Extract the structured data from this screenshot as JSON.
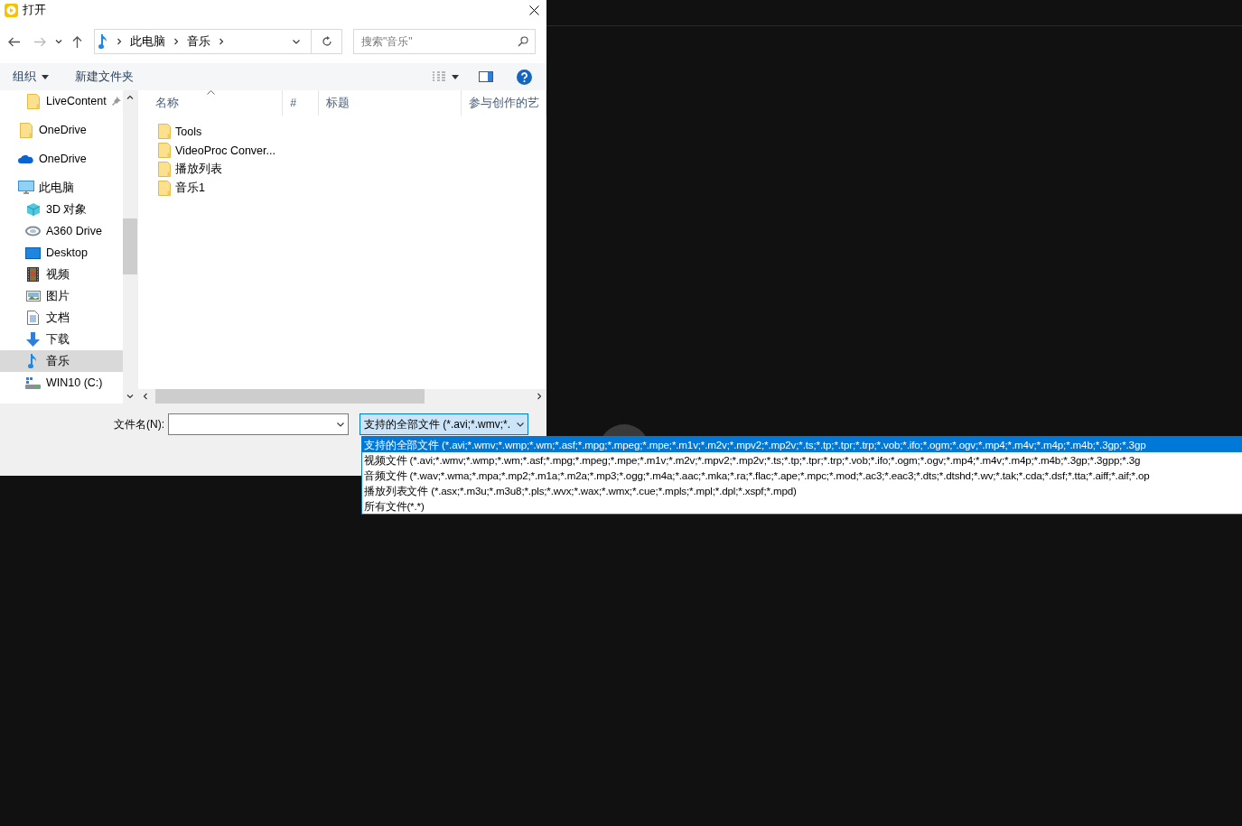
{
  "window": {
    "title": "打开"
  },
  "address": {
    "path": [
      "此电脑",
      "音乐"
    ]
  },
  "search": {
    "placeholder": "搜索\"音乐\""
  },
  "toolbar": {
    "organize": "组织",
    "new_folder": "新建文件夹"
  },
  "sidebar": {
    "items": [
      {
        "label": "LiveContent",
        "kind": "pinned-folder",
        "selected": false
      },
      {
        "label": "OneDrive",
        "kind": "folder",
        "selected": false
      },
      {
        "label": "OneDrive",
        "kind": "cloud",
        "selected": false
      },
      {
        "label": "此电脑",
        "kind": "pc",
        "selected": false,
        "children": [
          {
            "label": "3D 对象",
            "kind": "cube",
            "selected": false
          },
          {
            "label": "A360 Drive",
            "kind": "a360",
            "selected": false
          },
          {
            "label": "Desktop",
            "kind": "desktop",
            "selected": false
          },
          {
            "label": "视频",
            "kind": "video",
            "selected": false
          },
          {
            "label": "图片",
            "kind": "picture",
            "selected": false
          },
          {
            "label": "文档",
            "kind": "document",
            "selected": false
          },
          {
            "label": "下载",
            "kind": "download",
            "selected": false
          },
          {
            "label": "音乐",
            "kind": "music",
            "selected": true
          },
          {
            "label": "WIN10 (C:)",
            "kind": "drive",
            "selected": false
          }
        ]
      }
    ]
  },
  "columns": [
    {
      "label": "名称",
      "sorted": true
    },
    {
      "label": "#",
      "sorted": false
    },
    {
      "label": "标题",
      "sorted": false
    },
    {
      "label": "参与创作的艺",
      "sorted": false
    }
  ],
  "files": [
    {
      "name": "Tools"
    },
    {
      "name": "VideoProc Conver..."
    },
    {
      "name": "播放列表"
    },
    {
      "name": "音乐1"
    }
  ],
  "footer": {
    "filename_label": "文件名(N):",
    "file_type": "支持的全部文件 (*.avi;*.wmv;*."
  },
  "file_types": [
    {
      "label": "支持的全部文件 (*.avi;*.wmv;*.wmp;*.wm;*.asf;*.mpg;*.mpeg;*.mpe;*.m1v;*.m2v;*.mpv2;*.mp2v;*.ts;*.tp;*.tpr;*.trp;*.vob;*.ifo;*.ogm;*.ogv;*.mp4;*.m4v;*.m4p;*.m4b;*.3gp;*.3gp",
      "selected": true
    },
    {
      "label": "视频文件 (*.avi;*.wmv;*.wmp;*.wm;*.asf;*.mpg;*.mpeg;*.mpe;*.m1v;*.m2v;*.mpv2;*.mp2v;*.ts;*.tp;*.tpr;*.trp;*.vob;*.ifo;*.ogm;*.ogv;*.mp4;*.m4v;*.m4p;*.m4b;*.3gp;*.3gpp;*.3g",
      "selected": false
    },
    {
      "label": "音频文件 (*.wav;*.wma;*.mpa;*.mp2;*.m1a;*.m2a;*.mp3;*.ogg;*.m4a;*.aac;*.mka;*.ra;*.flac;*.ape;*.mpc;*.mod;*.ac3;*.eac3;*.dts;*.dtshd;*.wv;*.tak;*.cda;*.dsf;*.tta;*.aiff;*.aif;*.op",
      "selected": false
    },
    {
      "label": "播放列表文件 (*.asx;*.m3u;*.m3u8;*.pls;*.wvx;*.wax;*.wmx;*.cue;*.mpls;*.mpl;*.dpl;*.xspf;*.mpd)",
      "selected": false
    },
    {
      "label": "所有文件(*.*)",
      "selected": false
    }
  ]
}
